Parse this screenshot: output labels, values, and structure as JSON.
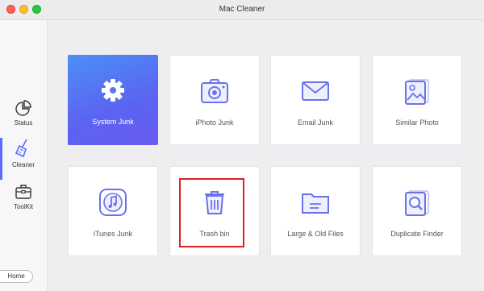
{
  "window": {
    "title": "Mac Cleaner"
  },
  "sidebar": {
    "items": [
      {
        "label": "Status",
        "icon": "pie-chart-icon"
      },
      {
        "label": "Cleaner",
        "icon": "broom-icon",
        "active": true
      },
      {
        "label": "ToolKit",
        "icon": "toolbox-icon"
      }
    ],
    "home_label": "Home"
  },
  "tiles": [
    {
      "label": "System Junk",
      "icon": "gear-icon",
      "selected": true
    },
    {
      "label": "iPhoto Junk",
      "icon": "camera-icon"
    },
    {
      "label": "Email Junk",
      "icon": "envelope-icon"
    },
    {
      "label": "Similar Photo",
      "icon": "photo-icon"
    },
    {
      "label": "iTunes Junk",
      "icon": "music-note-icon"
    },
    {
      "label": "Trash bin",
      "icon": "trash-icon",
      "highlighted": true
    },
    {
      "label": "Large & Old Files",
      "icon": "folder-icon"
    },
    {
      "label": "Duplicate Finder",
      "icon": "magnifier-doc-icon"
    }
  ],
  "colors": {
    "accent": "#5b6cff",
    "icon_stroke": "#6a72e8",
    "highlight": "#e02020"
  }
}
